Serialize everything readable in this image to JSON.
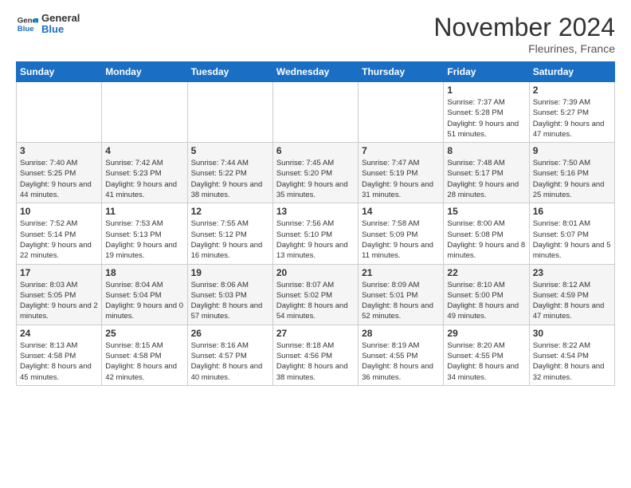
{
  "header": {
    "logo_general": "General",
    "logo_blue": "Blue",
    "title": "November 2024",
    "location": "Fleurines, France"
  },
  "days_of_week": [
    "Sunday",
    "Monday",
    "Tuesday",
    "Wednesday",
    "Thursday",
    "Friday",
    "Saturday"
  ],
  "weeks": [
    [
      {
        "day": "",
        "info": ""
      },
      {
        "day": "",
        "info": ""
      },
      {
        "day": "",
        "info": ""
      },
      {
        "day": "",
        "info": ""
      },
      {
        "day": "",
        "info": ""
      },
      {
        "day": "1",
        "info": "Sunrise: 7:37 AM\nSunset: 5:28 PM\nDaylight: 9 hours and 51 minutes."
      },
      {
        "day": "2",
        "info": "Sunrise: 7:39 AM\nSunset: 5:27 PM\nDaylight: 9 hours and 47 minutes."
      }
    ],
    [
      {
        "day": "3",
        "info": "Sunrise: 7:40 AM\nSunset: 5:25 PM\nDaylight: 9 hours and 44 minutes."
      },
      {
        "day": "4",
        "info": "Sunrise: 7:42 AM\nSunset: 5:23 PM\nDaylight: 9 hours and 41 minutes."
      },
      {
        "day": "5",
        "info": "Sunrise: 7:44 AM\nSunset: 5:22 PM\nDaylight: 9 hours and 38 minutes."
      },
      {
        "day": "6",
        "info": "Sunrise: 7:45 AM\nSunset: 5:20 PM\nDaylight: 9 hours and 35 minutes."
      },
      {
        "day": "7",
        "info": "Sunrise: 7:47 AM\nSunset: 5:19 PM\nDaylight: 9 hours and 31 minutes."
      },
      {
        "day": "8",
        "info": "Sunrise: 7:48 AM\nSunset: 5:17 PM\nDaylight: 9 hours and 28 minutes."
      },
      {
        "day": "9",
        "info": "Sunrise: 7:50 AM\nSunset: 5:16 PM\nDaylight: 9 hours and 25 minutes."
      }
    ],
    [
      {
        "day": "10",
        "info": "Sunrise: 7:52 AM\nSunset: 5:14 PM\nDaylight: 9 hours and 22 minutes."
      },
      {
        "day": "11",
        "info": "Sunrise: 7:53 AM\nSunset: 5:13 PM\nDaylight: 9 hours and 19 minutes."
      },
      {
        "day": "12",
        "info": "Sunrise: 7:55 AM\nSunset: 5:12 PM\nDaylight: 9 hours and 16 minutes."
      },
      {
        "day": "13",
        "info": "Sunrise: 7:56 AM\nSunset: 5:10 PM\nDaylight: 9 hours and 13 minutes."
      },
      {
        "day": "14",
        "info": "Sunrise: 7:58 AM\nSunset: 5:09 PM\nDaylight: 9 hours and 11 minutes."
      },
      {
        "day": "15",
        "info": "Sunrise: 8:00 AM\nSunset: 5:08 PM\nDaylight: 9 hours and 8 minutes."
      },
      {
        "day": "16",
        "info": "Sunrise: 8:01 AM\nSunset: 5:07 PM\nDaylight: 9 hours and 5 minutes."
      }
    ],
    [
      {
        "day": "17",
        "info": "Sunrise: 8:03 AM\nSunset: 5:05 PM\nDaylight: 9 hours and 2 minutes."
      },
      {
        "day": "18",
        "info": "Sunrise: 8:04 AM\nSunset: 5:04 PM\nDaylight: 9 hours and 0 minutes."
      },
      {
        "day": "19",
        "info": "Sunrise: 8:06 AM\nSunset: 5:03 PM\nDaylight: 8 hours and 57 minutes."
      },
      {
        "day": "20",
        "info": "Sunrise: 8:07 AM\nSunset: 5:02 PM\nDaylight: 8 hours and 54 minutes."
      },
      {
        "day": "21",
        "info": "Sunrise: 8:09 AM\nSunset: 5:01 PM\nDaylight: 8 hours and 52 minutes."
      },
      {
        "day": "22",
        "info": "Sunrise: 8:10 AM\nSunset: 5:00 PM\nDaylight: 8 hours and 49 minutes."
      },
      {
        "day": "23",
        "info": "Sunrise: 8:12 AM\nSunset: 4:59 PM\nDaylight: 8 hours and 47 minutes."
      }
    ],
    [
      {
        "day": "24",
        "info": "Sunrise: 8:13 AM\nSunset: 4:58 PM\nDaylight: 8 hours and 45 minutes."
      },
      {
        "day": "25",
        "info": "Sunrise: 8:15 AM\nSunset: 4:58 PM\nDaylight: 8 hours and 42 minutes."
      },
      {
        "day": "26",
        "info": "Sunrise: 8:16 AM\nSunset: 4:57 PM\nDaylight: 8 hours and 40 minutes."
      },
      {
        "day": "27",
        "info": "Sunrise: 8:18 AM\nSunset: 4:56 PM\nDaylight: 8 hours and 38 minutes."
      },
      {
        "day": "28",
        "info": "Sunrise: 8:19 AM\nSunset: 4:55 PM\nDaylight: 8 hours and 36 minutes."
      },
      {
        "day": "29",
        "info": "Sunrise: 8:20 AM\nSunset: 4:55 PM\nDaylight: 8 hours and 34 minutes."
      },
      {
        "day": "30",
        "info": "Sunrise: 8:22 AM\nSunset: 4:54 PM\nDaylight: 8 hours and 32 minutes."
      }
    ]
  ]
}
